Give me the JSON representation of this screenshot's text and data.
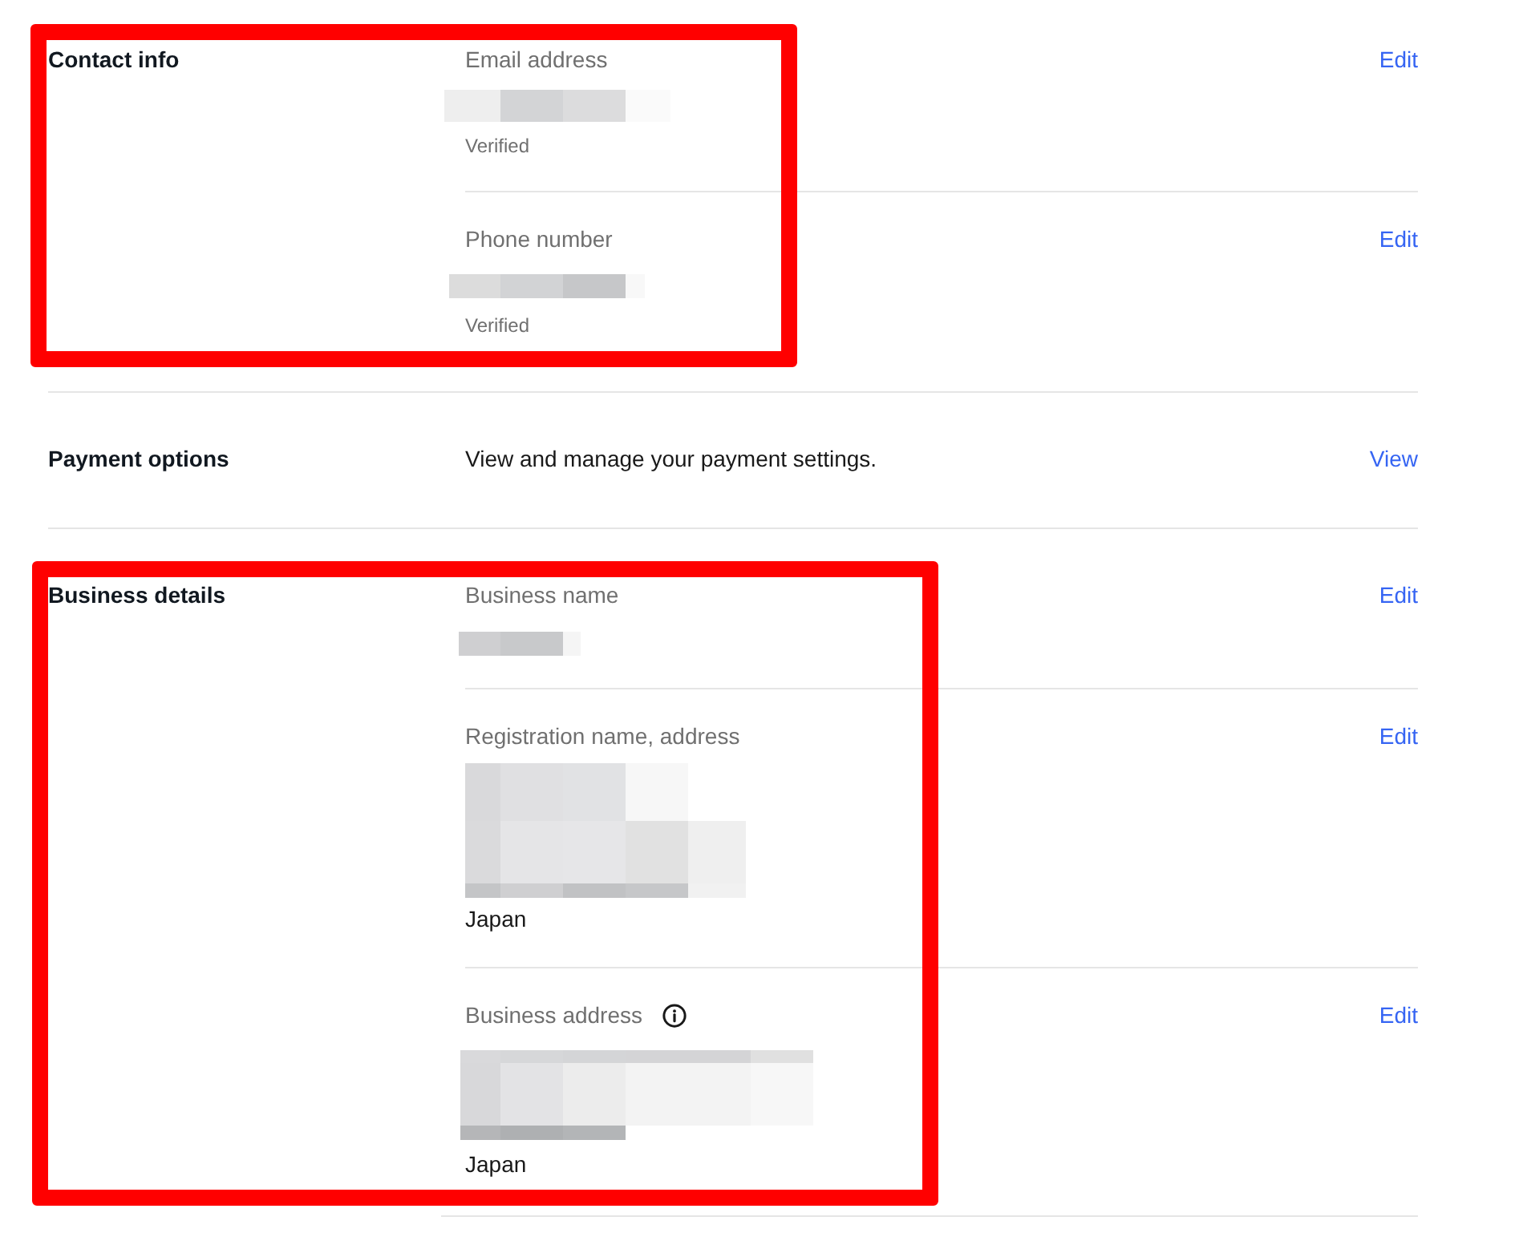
{
  "sections": [
    {
      "title": "Contact info",
      "highlighted": true,
      "fields": [
        {
          "label": "Email address",
          "info": false,
          "lines": [
            {
              "kind": "redacted"
            },
            {
              "kind": "note",
              "text": "Verified"
            }
          ],
          "action": "Edit"
        },
        {
          "label": "Phone number",
          "info": false,
          "lines": [
            {
              "kind": "redacted"
            },
            {
              "kind": "note",
              "text": "Verified"
            }
          ],
          "action": "Edit"
        }
      ]
    },
    {
      "title": "Payment options",
      "highlighted": false,
      "description": "View and manage your payment settings.",
      "action": "View"
    },
    {
      "title": "Business details",
      "highlighted": true,
      "fields": [
        {
          "label": "Business name",
          "info": false,
          "lines": [
            {
              "kind": "redacted"
            }
          ],
          "action": "Edit"
        },
        {
          "label": "Registration name, address",
          "info": false,
          "lines": [
            {
              "kind": "redacted"
            },
            {
              "kind": "text",
              "text": "Japan"
            }
          ],
          "action": "Edit"
        },
        {
          "label": "Business address",
          "info": true,
          "lines": [
            {
              "kind": "redacted"
            },
            {
              "kind": "text",
              "text": "Japan"
            }
          ],
          "action": "Edit"
        }
      ]
    }
  ]
}
